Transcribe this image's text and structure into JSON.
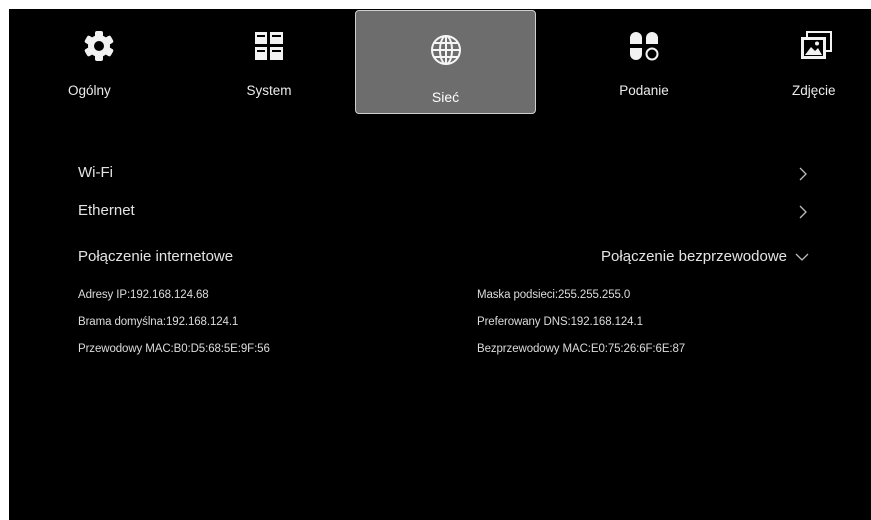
{
  "tabs": [
    {
      "label": "Ogólny",
      "icon": "gear-icon"
    },
    {
      "label": "System",
      "icon": "windows-icon"
    },
    {
      "label": "Sieć",
      "icon": "globe-icon",
      "active": true
    },
    {
      "label": "Podanie",
      "icon": "apps-icon"
    },
    {
      "label": "Zdjęcie",
      "icon": "picture-icon"
    }
  ],
  "menu": {
    "wifi": "Wi-Fi",
    "ethernet": "Ethernet"
  },
  "internet": {
    "title": "Połączenie internetowe",
    "connection_type": "Połączenie bezprzewodowe"
  },
  "details": {
    "ip": "Adresy IP:192.168.124.68",
    "gateway": "Brama domyślna:192.168.124.1",
    "wired_mac": "Przewodowy MAC:B0:D5:68:5E:9F:56",
    "subnet": "Maska podsieci:255.255.255.0",
    "dns": "Preferowany DNS:192.168.124.1",
    "wireless_mac": "Bezprzewodowy MAC:E0:75:26:6F:6E:87"
  },
  "colors": {
    "background": "#000000",
    "active_tab": "#6d6d6d",
    "text": "#e4e4e4"
  }
}
